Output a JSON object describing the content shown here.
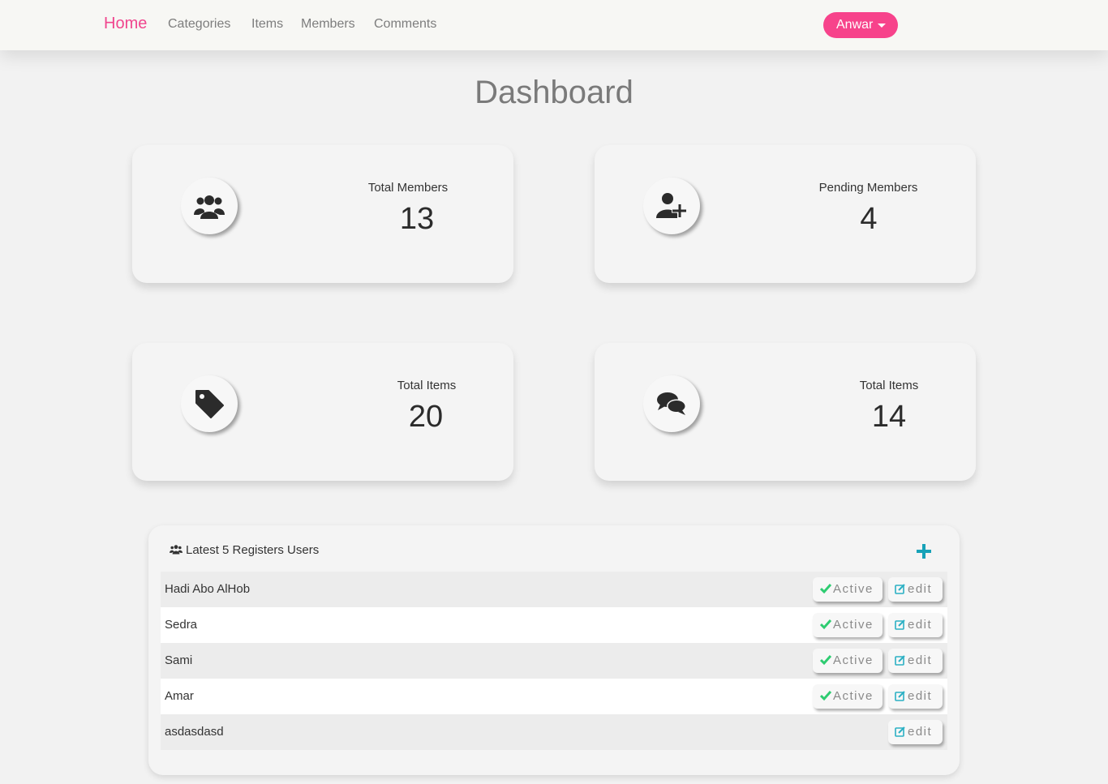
{
  "navbar": {
    "brand": "Home",
    "links": [
      "Categories",
      "Items",
      "Members",
      "Comments"
    ],
    "user_menu": "Anwar"
  },
  "page": {
    "title": "Dashboard"
  },
  "stats": [
    {
      "label": "Total Members",
      "value": "13",
      "icon": "users-icon"
    },
    {
      "label": "Pending Members",
      "value": "4",
      "icon": "user-plus-icon"
    },
    {
      "label": "Total Items",
      "value": "20",
      "icon": "tag-icon"
    },
    {
      "label": "Total Items",
      "value": "14",
      "icon": "comments-icon"
    }
  ],
  "latest_users": {
    "heading": "Latest 5 Registers Users",
    "heading_icon": "users-icon",
    "add_icon": "plus-icon",
    "rows": [
      {
        "name": "Hadi Abo AlHob",
        "active_label": "Active",
        "edit_label": "edit"
      },
      {
        "name": "Sedra",
        "active_label": "Active",
        "edit_label": "edit"
      },
      {
        "name": "Sami",
        "active_label": "Active",
        "edit_label": "edit"
      },
      {
        "name": "Amar",
        "active_label": "Active",
        "edit_label": "edit"
      },
      {
        "name": "asdasdasd",
        "edit_label": "edit"
      }
    ]
  },
  "colors": {
    "brand_pink": "#f0468e",
    "button_pink": "#f7438b",
    "active_green": "#2ecc71",
    "edit_teal": "#2bb0c4",
    "add_teal": "#17a2b8"
  }
}
